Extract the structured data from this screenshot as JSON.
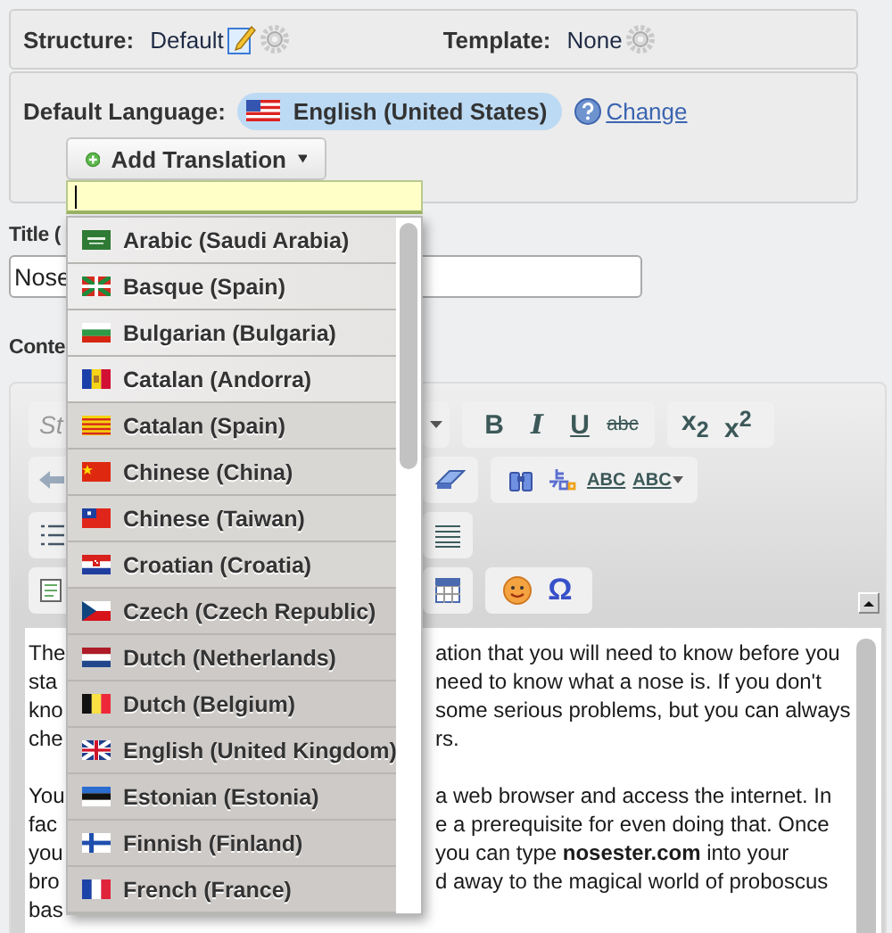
{
  "structure": {
    "label": "Structure:",
    "value": "Default"
  },
  "template": {
    "label": "Template:",
    "value": "None"
  },
  "default_language": {
    "label": "Default Language:",
    "value": "English (United States)",
    "link": "Change"
  },
  "add_translation": {
    "label": "Add Translation"
  },
  "languages": [
    {
      "label": "Arabic (Saudi Arabia)"
    },
    {
      "label": "Basque (Spain)"
    },
    {
      "label": "Bulgarian (Bulgaria)"
    },
    {
      "label": "Catalan (Andorra)"
    },
    {
      "label": "Catalan (Spain)"
    },
    {
      "label": "Chinese (China)"
    },
    {
      "label": "Chinese (Taiwan)"
    },
    {
      "label": "Croatian (Croatia)"
    },
    {
      "label": "Czech (Czech Republic)"
    },
    {
      "label": "Dutch (Netherlands)"
    },
    {
      "label": "Dutch (Belgium)"
    },
    {
      "label": "English (United Kingdom)"
    },
    {
      "label": "Estonian (Estonia)"
    },
    {
      "label": "Finnish (Finland)"
    },
    {
      "label": "French (France)"
    }
  ],
  "title": {
    "label": "Title (",
    "value": "Nose"
  },
  "content": {
    "label": "Conte"
  },
  "toolbar": {
    "styles_placeholder": "St",
    "format_buttons": [
      "B",
      "I",
      "U",
      "abc"
    ],
    "script_buttons": [
      "x$_{2}$",
      "x$^{2}$"
    ],
    "spell_buttons": [
      "ABC",
      "ABC"
    ],
    "special_char": "Ω"
  },
  "editor": {
    "paragraphs": [
      {
        "lines": [
          {
            "left": "The",
            "right": "ation that you will need to know before you"
          },
          {
            "left": "sta",
            "right": "need to know what a nose is. If you don't"
          },
          {
            "left": "kno",
            "right": "some serious problems, but you can always"
          },
          {
            "left": "che",
            "right": "rs."
          }
        ]
      },
      {
        "lines": [
          {
            "left": "You",
            "right": "a web browser and access the internet. In"
          },
          {
            "left": "fac",
            "right": "e a prerequisite for even doing that. Once"
          },
          {
            "left": "you",
            "right": "you can type **nosester.com** into your"
          },
          {
            "left": "bro",
            "right": "d away to the magical world of proboscus"
          },
          {
            "left": "bas"
          }
        ]
      }
    ]
  }
}
